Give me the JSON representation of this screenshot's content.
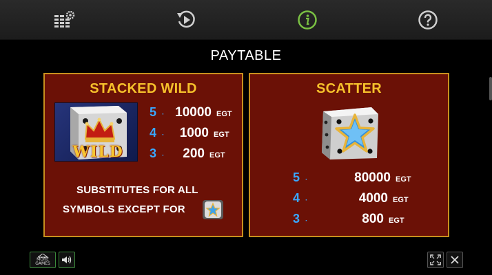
{
  "toolbar": {
    "items": [
      {
        "name": "settings-icon"
      },
      {
        "name": "replay-icon"
      },
      {
        "name": "info-icon",
        "active": true
      },
      {
        "name": "help-icon"
      }
    ],
    "active_color": "#7ac143"
  },
  "title": "PAYTABLE",
  "stacked_wild": {
    "heading": "STACKED WILD",
    "symbol_text": "WILD",
    "payouts": [
      {
        "count": "5",
        "amount": "10000",
        "unit": "EGT"
      },
      {
        "count": "4",
        "amount": "1000",
        "unit": "EGT"
      },
      {
        "count": "3",
        "amount": "200",
        "unit": "EGT"
      }
    ],
    "substitutes_line1": "SUBSTITUTES FOR ALL",
    "substitutes_line2": "SYMBOLS EXCEPT FOR"
  },
  "scatter": {
    "heading": "SCATTER",
    "payouts": [
      {
        "count": "5",
        "amount": "80000",
        "unit": "EGT"
      },
      {
        "count": "4",
        "amount": "4000",
        "unit": "EGT"
      },
      {
        "count": "3",
        "amount": "800",
        "unit": "EGT"
      }
    ]
  },
  "bottom": {
    "more_games_line1": "MORE",
    "more_games_line2": "GAMES"
  },
  "colors": {
    "panel_bg": "#6b1106",
    "panel_border": "#c8901e",
    "heading": "#f5c02b",
    "count": "#39a7ff"
  }
}
